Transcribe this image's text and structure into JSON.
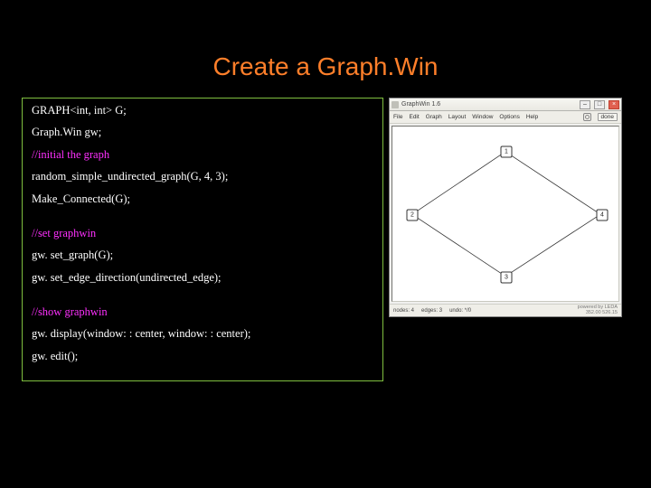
{
  "title": "Create a Graph.Win",
  "code": {
    "l1": "GRAPH<int, int> G;",
    "l2": "Graph.Win gw;",
    "c1": "//initial the graph",
    "l3": "random_simple_undirected_graph(G, 4, 3);",
    "l4": "Make_Connected(G);",
    "c2": "//set graphwin",
    "l5": "gw. set_graph(G);",
    "l6": "gw. set_edge_direction(undirected_edge);",
    "c3": "//show graphwin",
    "l7": "gw. display(window: : center, window: : center);",
    "l8": "gw. edit();"
  },
  "win": {
    "title": "GraphWin 1.6",
    "menu": {
      "file": "File",
      "edit": "Edit",
      "graph": "Graph",
      "layout": "Layout",
      "window": "Window",
      "options": "Options",
      "help": "Help",
      "done": "done"
    },
    "nodes": {
      "n1": "1",
      "n2": "2",
      "n3": "3",
      "n4": "4"
    },
    "status": {
      "nodes": "nodes: 4",
      "edges": "edges: 3",
      "undo": "undo: */0",
      "credit": "powered by LEDA",
      "coords": "352.00  526.15"
    },
    "btn": {
      "min": "–",
      "max": "□",
      "close": "×"
    }
  }
}
